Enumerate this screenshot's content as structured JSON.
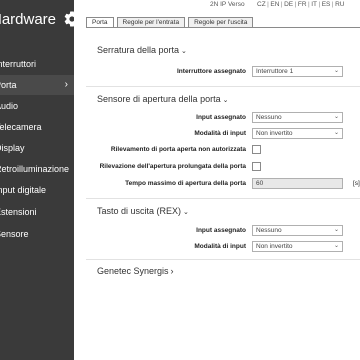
{
  "sidebar": {
    "brand": "Hardware",
    "items": [
      {
        "label": "Interruttori"
      },
      {
        "label": "Porta"
      },
      {
        "label": "Audio"
      },
      {
        "label": "Telecamera"
      },
      {
        "label": "Display"
      },
      {
        "label": "Retroilluminazione"
      },
      {
        "label": "Input digitale"
      },
      {
        "label": "Estensioni"
      },
      {
        "label": "Sensore"
      }
    ]
  },
  "topbar": {
    "device": "2N IP Verso",
    "languages": [
      "CZ",
      "EN",
      "DE",
      "FR",
      "IT",
      "ES",
      "RU"
    ]
  },
  "tabs": [
    "Porta",
    "Regole per l'entrata",
    "Regole per l'uscita"
  ],
  "serratura": {
    "title": "Serratura della porta",
    "interruttore_label": "Interruttore assegnato",
    "interruttore_value": "Interruttore 1"
  },
  "sensore": {
    "title": "Sensore di apertura della porta",
    "input_label": "Input assegnato",
    "input_value": "Nessuno",
    "modalita_label": "Modalità di input",
    "modalita_value": "Non invertito",
    "rilevamento_label": "Rilevamento di porta aperta non autorizzata",
    "rilevazione_label": "Rilevazione dell'apertura prolungata della porta",
    "tempo_label": "Tempo massimo di apertura della porta",
    "tempo_value": "60",
    "tempo_unit": "[s]"
  },
  "uscita": {
    "title": "Tasto di uscita (REX)",
    "input_label": "Input assegnato",
    "input_value": "Nessuno",
    "modalita_label": "Modalità di input",
    "modalita_value": "Non invertito"
  },
  "synergis": {
    "title": "Genetec Synergis"
  },
  "icons": {
    "settings": "gear-icon",
    "active_item": "chevron-right-icon",
    "section_toggle": "chevron-down-icon",
    "select_caret": "chevron-down-icon"
  }
}
